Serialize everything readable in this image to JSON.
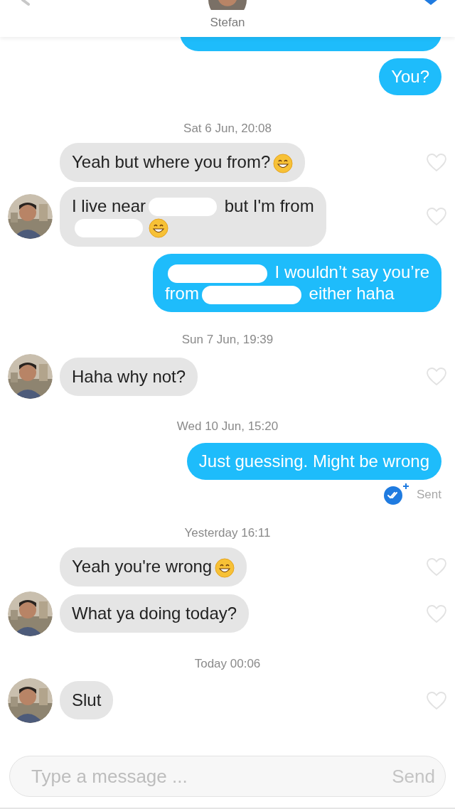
{
  "header": {
    "name": "Stefan"
  },
  "messages": [
    {
      "kind": "sent_hidden"
    },
    {
      "kind": "sent",
      "segments": [
        {
          "kind": "text",
          "text": "You?"
        }
      ]
    },
    {
      "kind": "date",
      "text": "Sat 6 Jun, 20:08"
    },
    {
      "kind": "received",
      "avatar": false,
      "liked": false,
      "segments": [
        {
          "kind": "text",
          "text": "Yeah but where you from?"
        },
        {
          "kind": "emoji"
        }
      ]
    },
    {
      "kind": "received",
      "avatar": true,
      "liked": false,
      "segments": [
        {
          "kind": "text",
          "text": "I live near"
        },
        {
          "kind": "redaction"
        },
        {
          "kind": "text",
          "text": "but I'm from"
        },
        {
          "kind": "break"
        },
        {
          "kind": "redaction"
        },
        {
          "kind": "emoji"
        }
      ]
    },
    {
      "kind": "sent",
      "segments": [
        {
          "kind": "redaction"
        },
        {
          "kind": "text",
          "text": "I wouldn’t say you’re"
        },
        {
          "kind": "break"
        },
        {
          "kind": "text",
          "text": "from"
        },
        {
          "kind": "redaction"
        },
        {
          "kind": "text",
          "text": "either haha"
        }
      ]
    },
    {
      "kind": "date",
      "text": "Sun 7 Jun, 19:39"
    },
    {
      "kind": "received",
      "avatar": true,
      "liked": false,
      "segments": [
        {
          "kind": "text",
          "text": "Haha why not?"
        }
      ]
    },
    {
      "kind": "date",
      "text": "Wed 10 Jun, 15:20"
    },
    {
      "kind": "sent",
      "segments": [
        {
          "kind": "text",
          "text": "Just guessing. Might be wrong"
        }
      ]
    },
    {
      "kind": "status",
      "text": "Sent"
    },
    {
      "kind": "date",
      "text": "Yesterday 16:11"
    },
    {
      "kind": "received",
      "avatar": false,
      "liked": false,
      "segments": [
        {
          "kind": "text",
          "text": "Yeah you're wrong"
        },
        {
          "kind": "emoji"
        }
      ]
    },
    {
      "kind": "received",
      "avatar": true,
      "liked": false,
      "segments": [
        {
          "kind": "text",
          "text": "What ya doing today?"
        }
      ]
    },
    {
      "kind": "date",
      "text": "Today 00:06"
    },
    {
      "kind": "received",
      "avatar": true,
      "liked": false,
      "segments": [
        {
          "kind": "text",
          "text": "Slut"
        }
      ]
    }
  ],
  "composer": {
    "placeholder": "Type a message ...",
    "send": "Send"
  }
}
